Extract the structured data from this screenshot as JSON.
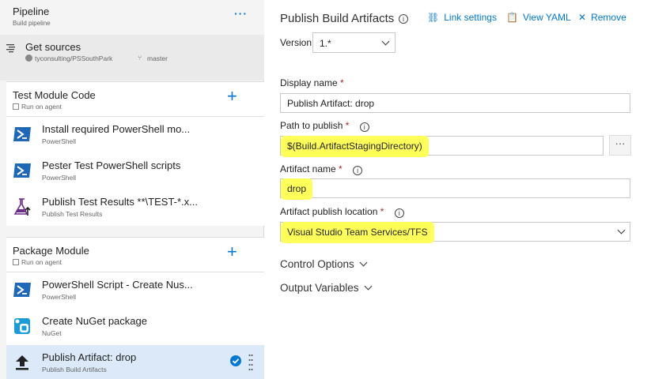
{
  "pipeline": {
    "title": "Pipeline",
    "subtitle": "Build pipeline",
    "more": "···"
  },
  "get_sources": {
    "title": "Get sources",
    "repo": "tyconsulting/PSSouthPark",
    "branch": "master"
  },
  "phases": [
    {
      "title": "Test Module Code",
      "subtitle": "Run on agent",
      "tasks": [
        {
          "title": "Install required PowerShell mo...",
          "subtitle": "PowerShell"
        },
        {
          "title": "Pester Test PowerShell scripts",
          "subtitle": "PowerShell"
        },
        {
          "title": "Publish Test Results **\\TEST-*.x...",
          "subtitle": "Publish Test Results"
        }
      ]
    },
    {
      "title": "Package Module",
      "subtitle": "Run on agent",
      "tasks": [
        {
          "title": "PowerShell Script - Create Nus...",
          "subtitle": "PowerShell"
        },
        {
          "title": "Create NuGet package",
          "subtitle": "NuGet"
        },
        {
          "title": "Publish Artifact: drop",
          "subtitle": "Publish Build Artifacts",
          "selected": true
        }
      ]
    }
  ],
  "detail": {
    "title": "Publish Build Artifacts",
    "links": {
      "link_settings": "Link settings",
      "view_yaml": "View YAML",
      "remove": "Remove"
    },
    "version_label": "Version",
    "version_value": "1.*",
    "display_name": {
      "label": "Display name",
      "value": "Publish Artifact: drop"
    },
    "path_to_publish": {
      "label": "Path to publish",
      "value": "$(Build.ArtifactStagingDirectory)",
      "browse": "···"
    },
    "artifact_name": {
      "label": "Artifact name",
      "value": "drop"
    },
    "artifact_location": {
      "label": "Artifact publish location",
      "value": "Visual Studio Team Services/TFS"
    },
    "sections": {
      "control_options": "Control Options",
      "output_variables": "Output Variables"
    },
    "required_marker": "*"
  },
  "colors": {
    "accent": "#0078d4",
    "highlight": "#ffff5a",
    "selected_row": "#dbe9f8",
    "required": "#a4262c"
  },
  "icons": [
    "more-icon",
    "list-icon",
    "github-icon",
    "branch-icon",
    "powershell-icon",
    "flask-icon",
    "nuget-icon",
    "upload-icon",
    "check-icon",
    "grip-icon",
    "info-icon",
    "link-icon",
    "yaml-icon",
    "close-icon",
    "chevron-down-icon"
  ]
}
